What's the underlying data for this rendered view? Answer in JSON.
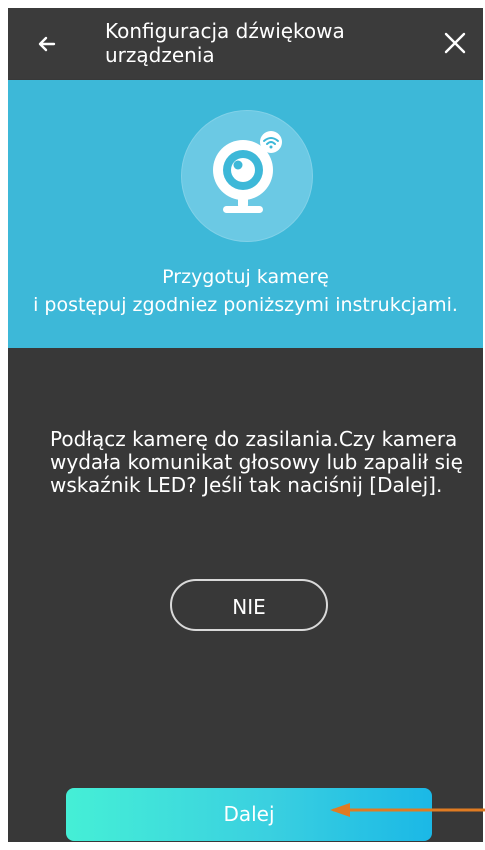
{
  "header": {
    "title_line1": "Konfiguracja dźwiękowa",
    "title_line2": "urządzenia",
    "back_icon": "back-arrow-icon",
    "close_icon": "close-icon"
  },
  "hero": {
    "line1": "Przygotuj kamerę",
    "line2": "i postępuj zgodniez poniższymi instrukcjami.",
    "background_color": "#3db8d8",
    "icon": "camera-wifi-icon"
  },
  "instruction": {
    "text": "Podłącz kamerę do zasilania.Czy kamera wydała komunikat głosowy lub zapalił się wskaźnik LED? Jeśli tak naciśnij [Dalej]."
  },
  "buttons": {
    "nie_label": "NIE",
    "dalej_label": "Dalej"
  },
  "overlay": {
    "annotation_color": "#e07b22"
  }
}
